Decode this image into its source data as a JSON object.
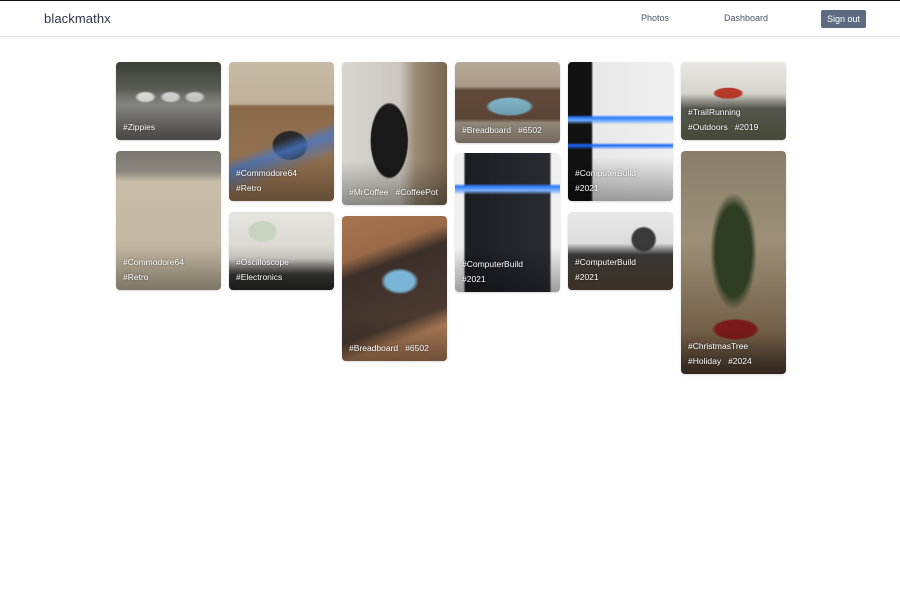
{
  "app": {
    "brand": "blackmathx"
  },
  "nav": {
    "photos": "Photos",
    "dashboard": "Dashboard",
    "sign_out": "Sign out"
  },
  "photos": [
    {
      "id": "zippies",
      "tags": [
        [
          "#Zippies"
        ]
      ]
    },
    {
      "id": "commodore64-a",
      "tags": [
        [
          "#Commodore64"
        ],
        [
          "#Retro"
        ]
      ]
    },
    {
      "id": "coffee",
      "tags": [
        [
          "#MrCoffee",
          "#CoffeePot"
        ]
      ]
    },
    {
      "id": "breadboard-a",
      "tags": [
        [
          "#Breadboard",
          "#6502"
        ]
      ]
    },
    {
      "id": "computerbuild-a",
      "tags": [
        [
          "#ComputerBuild"
        ],
        [
          "#2021"
        ]
      ]
    },
    {
      "id": "trailrunning",
      "tags": [
        [
          "#TrailRunning"
        ],
        [
          "#Outdoors",
          "#2019"
        ]
      ]
    },
    {
      "id": "commodore64-b",
      "tags": [
        [
          "#Commodore64"
        ],
        [
          "#Retro"
        ]
      ]
    },
    {
      "id": "oscilloscope",
      "tags": [
        [
          "#Oscilloscope"
        ],
        [
          "#Electronics"
        ]
      ]
    },
    {
      "id": "breadboard-b",
      "tags": [
        [
          "#Breadboard",
          "#6502"
        ]
      ]
    },
    {
      "id": "computerbuild-b",
      "tags": [
        [
          "#ComputerBuild"
        ],
        [
          "#2021"
        ]
      ]
    },
    {
      "id": "computerbuild-c",
      "tags": [
        [
          "#ComputerBuild"
        ],
        [
          "#2021"
        ]
      ]
    },
    {
      "id": "christmastree",
      "tags": [
        [
          "#ChristmasTree"
        ],
        [
          "#Holiday",
          "#2024"
        ]
      ]
    }
  ]
}
